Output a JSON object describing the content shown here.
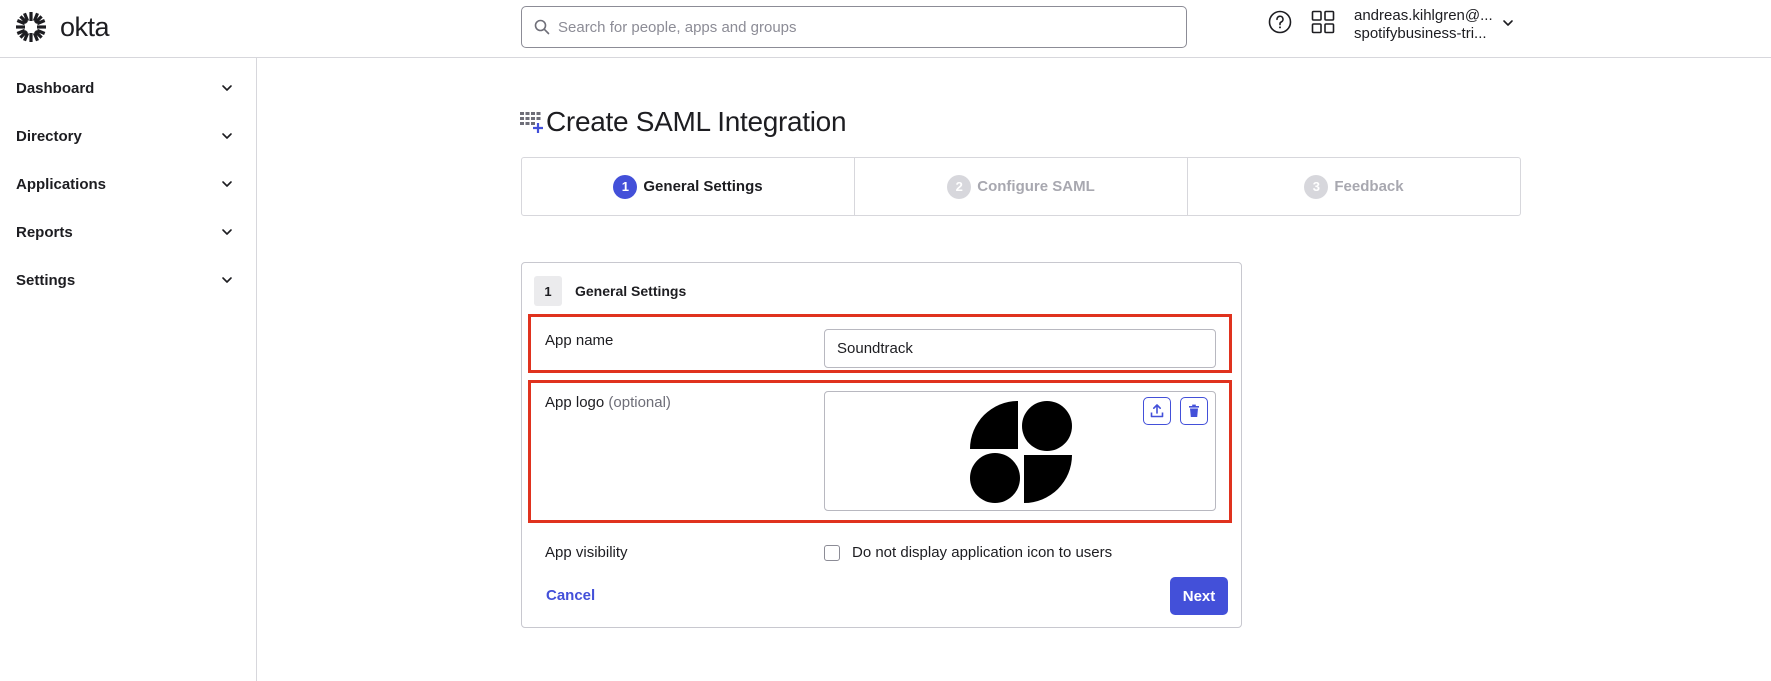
{
  "header": {
    "logo_text": "okta",
    "search_placeholder": "Search for people, apps and groups",
    "user_email": "andreas.kihlgren@...",
    "user_org": "spotifybusiness-tri..."
  },
  "sidebar": {
    "items": [
      {
        "label": "Dashboard"
      },
      {
        "label": "Directory"
      },
      {
        "label": "Applications"
      },
      {
        "label": "Reports"
      },
      {
        "label": "Settings"
      }
    ]
  },
  "page": {
    "title": "Create SAML Integration"
  },
  "steps": [
    {
      "number": "1",
      "label": "General Settings",
      "active": true
    },
    {
      "number": "2",
      "label": "Configure SAML",
      "active": false
    },
    {
      "number": "3",
      "label": "Feedback",
      "active": false
    }
  ],
  "form": {
    "section_number": "1",
    "section_title": "General Settings",
    "app_name_label": "App name",
    "app_name_value": "Soundtrack",
    "app_logo_label": "App logo",
    "app_logo_optional": "(optional)",
    "app_visibility_label": "App visibility",
    "visibility_checkbox_label": "Do not display application icon to users",
    "visibility_checked": false,
    "cancel_label": "Cancel",
    "next_label": "Next"
  },
  "colors": {
    "accent": "#4350d9",
    "highlight": "#e0321e",
    "border": "#d7d7dc"
  }
}
